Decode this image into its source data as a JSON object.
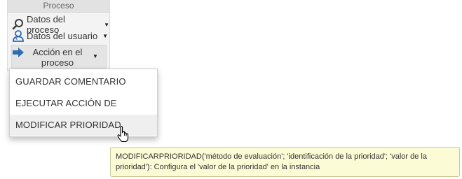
{
  "panel": {
    "title": "Proceso",
    "items": [
      {
        "label": "Datos del proceso",
        "icon": "magnifier-icon"
      },
      {
        "label": "Datos del usuario",
        "icon": "user-icon"
      },
      {
        "label": "Acción en el proceso",
        "icon": "arrow-right-icon"
      }
    ]
  },
  "dropdown": {
    "items": [
      {
        "label": "GUARDAR COMENTARIO"
      },
      {
        "label": "EJECUTAR ACCIÓN DE ACTIVIDAD"
      },
      {
        "label": "MODIFICAR PRIORIDAD"
      }
    ]
  },
  "tooltip": {
    "text": "MODIFICARPRIORIDAD('método de evaluación'; 'identificación de la prioridad'; 'valor de la prioridad'): Configura el 'valor de la prioridad' en la instancia"
  },
  "colors": {
    "accent_blue": "#2f6db3",
    "tooltip_bg": "#fbfbd5",
    "hover_bg": "#efefef"
  }
}
